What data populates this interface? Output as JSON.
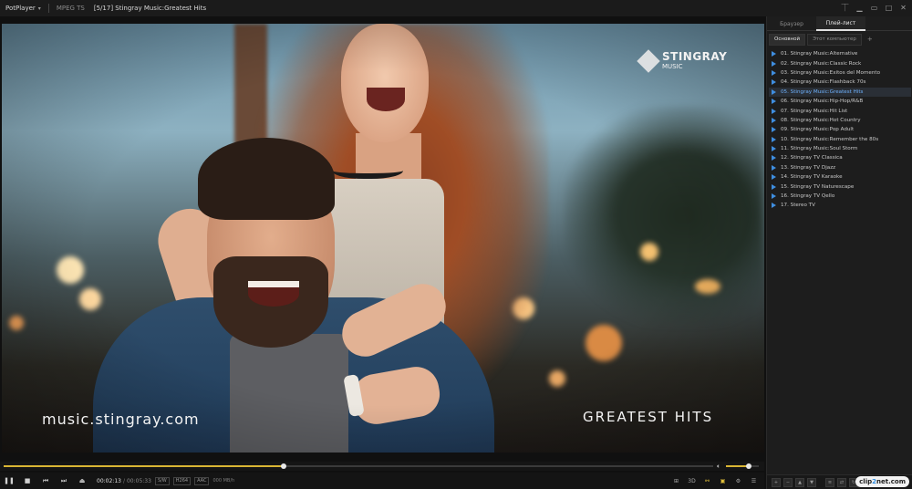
{
  "titlebar": {
    "app_name": "PotPlayer",
    "codec": "MPEG TS",
    "title": "[5/17] Stingray Music:Greatest Hits"
  },
  "video": {
    "watermark_brand": "STINGRAY",
    "watermark_sub": "MUSIC",
    "site_url": "music.stingray.com",
    "channel_caption": "GREATEST HITS"
  },
  "seek": {
    "progress": 0.395,
    "volume": 0.7
  },
  "controls": {
    "time_current": "00:02:13",
    "time_separator": "/",
    "time_total": "00:05:33",
    "tags": [
      "S/W",
      "H264",
      "AAC"
    ],
    "bitrate": "000 MB/h",
    "label_3d": "3D"
  },
  "panel": {
    "tabs": [
      "Браузер",
      "Плей-лист"
    ],
    "subtabs": [
      "Основной",
      "Этот компьютер"
    ],
    "add_label": "+",
    "playlist": [
      "01. Stingray Music:Alternative",
      "02. Stingray Music:Classic Rock",
      "03. Stingray Music:Exitos del Momento",
      "04. Stingray Music:Flashback 70s",
      "05. Stingray Music:Greatest Hits",
      "06. Stingray Music:Hip-Hop/R&B",
      "07. Stingray Music:Hit List",
      "08. Stingray Music:Hot Country",
      "09. Stingray Music:Pop Adult",
      "10. Stingray Music:Remember the 80s",
      "11. Stingray Music:Soul Storm",
      "12. Stingray TV Classica",
      "13. Stingray TV Djazz",
      "14. Stingray TV Karaoke",
      "15. Stingray TV Naturescape",
      "16. Stingray TV Qello",
      "17. Stereo TV"
    ],
    "current_index": 4,
    "footer_logo_a": "clip",
    "footer_logo_b": "2",
    "footer_logo_c": "net",
    "footer_logo_d": ".com"
  },
  "colors": {
    "accent": "#d9b534",
    "current_item": "#6fb3ff",
    "play_marker": "#3f8ee0"
  }
}
